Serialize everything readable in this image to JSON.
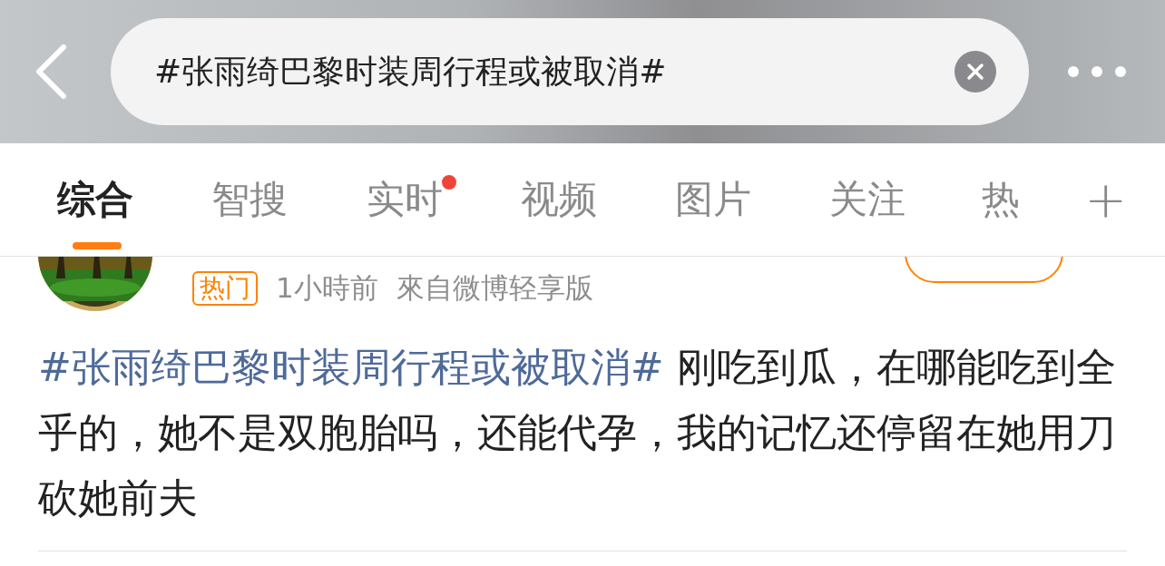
{
  "search": {
    "value": "#张雨绮巴黎时装周行程或被取消#"
  },
  "tabs": [
    {
      "label": "综合",
      "selected": true,
      "dot": false
    },
    {
      "label": "智搜",
      "selected": false,
      "dot": false
    },
    {
      "label": "实时",
      "selected": false,
      "dot": true
    },
    {
      "label": "视频",
      "selected": false,
      "dot": false
    },
    {
      "label": "图片",
      "selected": false,
      "dot": false
    },
    {
      "label": "关注",
      "selected": false,
      "dot": false
    },
    {
      "label": "热",
      "selected": false,
      "dot": false
    }
  ],
  "add_tab": {
    "label": "+"
  },
  "post": {
    "badge": "热门",
    "time": "1小時前",
    "source": "來自微博轻享版",
    "hashtag": "#张雨绮巴黎时装周行程或被取消#",
    "text": "刚吃到瓜，在哪能吃到全乎的，她不是双胞胎吗，还能代孕，我的记忆还停留在她用刀砍她前夫"
  }
}
